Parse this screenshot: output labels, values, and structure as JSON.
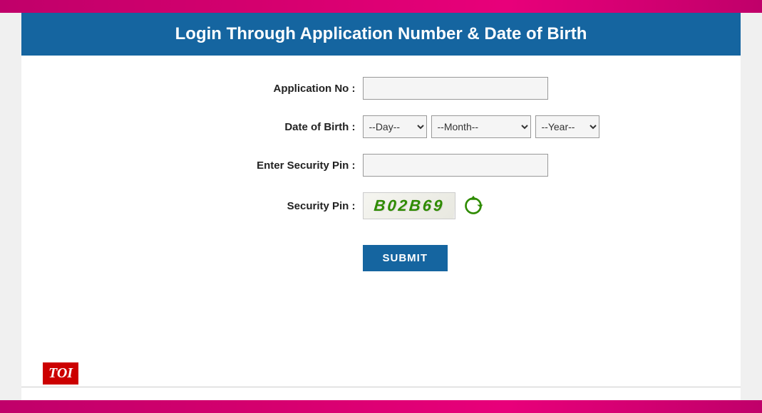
{
  "header": {
    "title": "Login Through Application Number & Date of Birth"
  },
  "form": {
    "application_no_label": "Application No :",
    "application_no_placeholder": "",
    "dob_label": "Date of Birth :",
    "dob_day_default": "--Day--",
    "dob_month_default": "--Month--",
    "dob_year_default": "--Year--",
    "security_pin_label": "Enter Security Pin :",
    "security_pin_placeholder": "",
    "captcha_label": "Security Pin :",
    "captcha_value": "B02B69",
    "submit_label": "SUBMIT"
  },
  "footer": {
    "toi_label": "TOI"
  },
  "colors": {
    "header_bg": "#1565a0",
    "submit_bg": "#1565a0",
    "top_bar": "#cc0070",
    "toi_red": "#cc0000",
    "captcha_green": "#2e8b00"
  }
}
